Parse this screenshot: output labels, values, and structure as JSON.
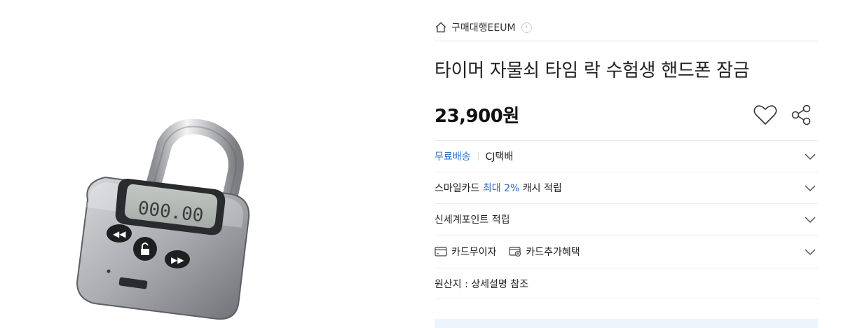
{
  "breadcrumb": {
    "shop_name": "구매대행EEUM"
  },
  "product": {
    "title": "타이머 자물쇠 타임 락 수험생 핸드폰 잠금",
    "price": "23,900",
    "currency_suffix": "원",
    "lcd_text": "000.00"
  },
  "info_rows": {
    "shipping": {
      "label": "무료배송",
      "carrier": "CJ택배"
    },
    "smile_card": {
      "prefix": "스마일카드 ",
      "highlight": "최대 2%",
      "suffix": " 캐시 적립"
    },
    "shinsegae": {
      "label": "신세계포인트 적립"
    },
    "card": {
      "installment_label": "카드무이자",
      "benefit_label": "카드추가혜택"
    },
    "origin": {
      "label": "원산지 : 상세설명 참조"
    }
  },
  "colors": {
    "accent_blue": "#2c6fd1",
    "divider": "#ececec"
  }
}
